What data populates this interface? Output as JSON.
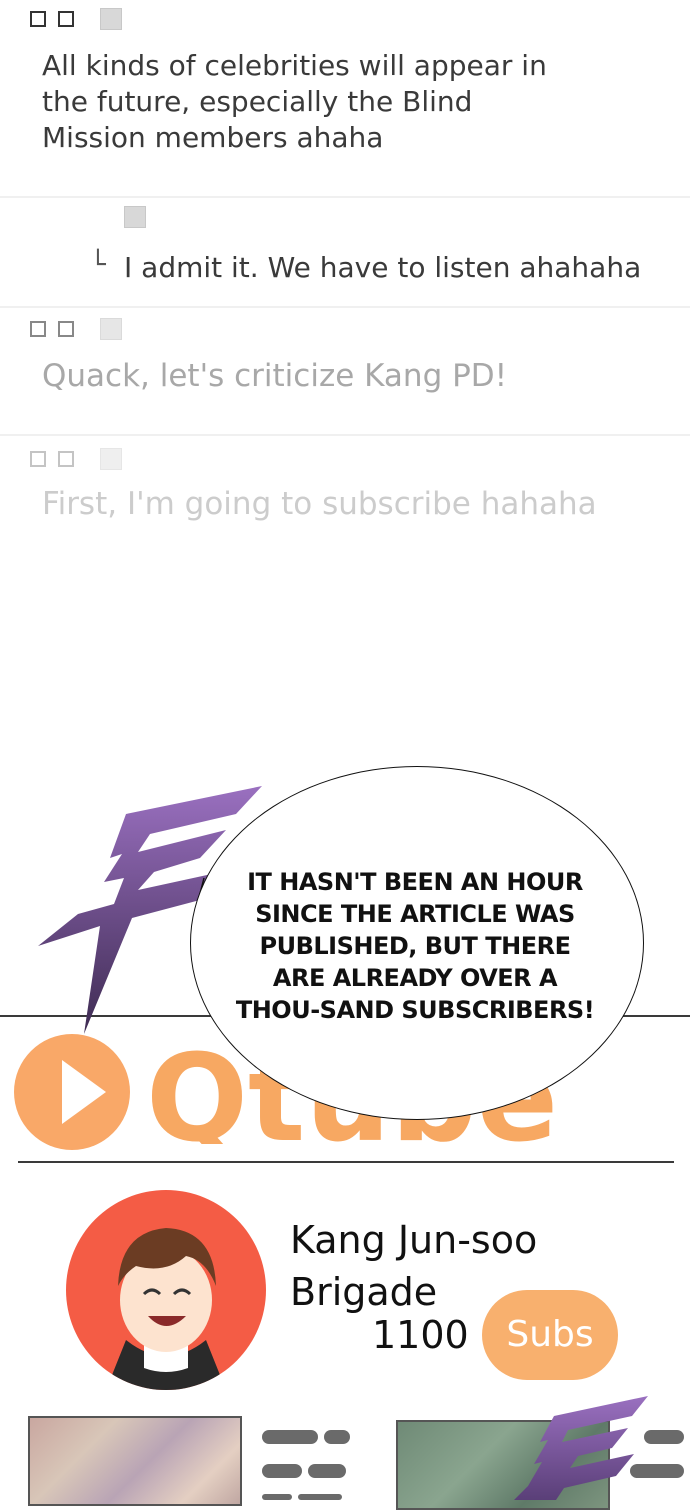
{
  "comments": [
    {
      "text": "All kinds of celebrities will appear in the future, especially the Blind Mission members ahaha"
    },
    {
      "text": "I admit it. We have to listen ahahaha",
      "reply_marker": "└"
    },
    {
      "text": "Quack, let's criticize Kang PD!"
    },
    {
      "text": "First, I'm going to subscribe hahaha"
    }
  ],
  "speech_bubble": {
    "text": "IT HASN'T BEEN AN HOUR SINCE THE ARTICLE WAS PUBLISHED, BUT THERE ARE ALREADY OVER A THOU-SAND SUBSCRIBERS!"
  },
  "platform": {
    "logo_text": "Qtube",
    "logo_icon": "play-icon",
    "accent_color": "#f7a862"
  },
  "channel": {
    "name": "Kang Jun-soo Brigade",
    "subscriber_count": "1100",
    "subscribe_label": "Subs",
    "avatar_color": "#f45c45"
  },
  "decor": {
    "lightning_color": "#8b62b0"
  }
}
